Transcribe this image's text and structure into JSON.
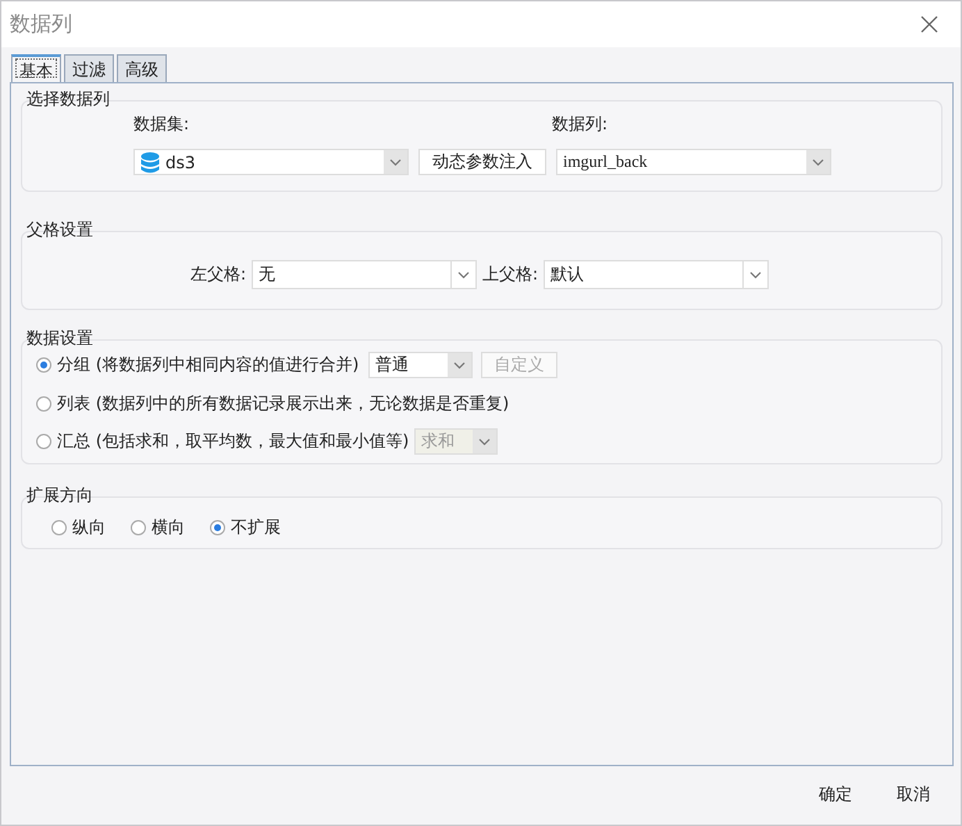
{
  "window": {
    "title": "数据列"
  },
  "tabs": [
    {
      "label": "基本",
      "selected": true
    },
    {
      "label": "过滤",
      "selected": false
    },
    {
      "label": "高级",
      "selected": false
    }
  ],
  "select_column": {
    "title": "选择数据列",
    "dataset_label": "数据集:",
    "dataset_value": "ds3",
    "param_button": "动态参数注入",
    "column_label": "数据列:",
    "column_value": "imgurl_back"
  },
  "parent_settings": {
    "title": "父格设置",
    "left_label": "左父格:",
    "left_value": "无",
    "top_label": "上父格:",
    "top_value": "默认"
  },
  "data_settings": {
    "title": "数据设置",
    "options": [
      {
        "kind": "group",
        "label": "分组 (将数据列中相同内容的值进行合并)",
        "selected": true,
        "combo": "普通",
        "button": "自定义",
        "button_disabled": true
      },
      {
        "kind": "list",
        "label": "列表 (数据列中的所有数据记录展示出来，无论数据是否重复)",
        "selected": false
      },
      {
        "kind": "summary",
        "label": "汇总 (包括求和，取平均数，最大值和最小值等)",
        "selected": false,
        "combo": "求和",
        "combo_disabled": true
      }
    ]
  },
  "expand_direction": {
    "title": "扩展方向",
    "options": [
      {
        "label": "纵向",
        "selected": false
      },
      {
        "label": "横向",
        "selected": false
      },
      {
        "label": "不扩展",
        "selected": true
      }
    ]
  },
  "buttons": [
    "确定",
    "取消"
  ]
}
